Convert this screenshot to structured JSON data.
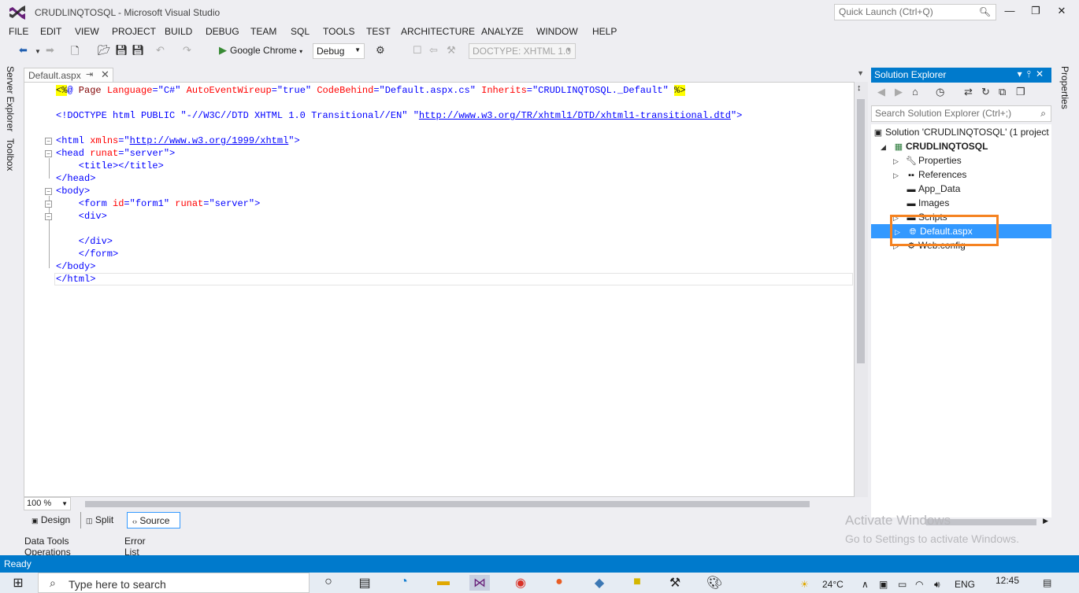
{
  "window": {
    "title": "CRUDLINQTOSQL - Microsoft Visual Studio",
    "quick_launch_placeholder": "Quick Launch (Ctrl+Q)"
  },
  "menu": [
    "FILE",
    "EDIT",
    "VIEW",
    "PROJECT",
    "BUILD",
    "DEBUG",
    "TEAM",
    "SQL",
    "TOOLS",
    "TEST",
    "ARCHITECTURE",
    "ANALYZE",
    "WINDOW",
    "HELP"
  ],
  "toolbar": {
    "run_target": "Google Chrome",
    "configuration": "Debug",
    "doctype": "DOCTYPE: XHTML 1.0"
  },
  "left_strip": {
    "server_explorer": "Server Explorer",
    "toolbox": "Toolbox"
  },
  "editor": {
    "tab_label": "Default.aspx",
    "zoom": "100 %",
    "code": {
      "l1_open": "<%",
      "l1_at": "@",
      "l1_page": " Page ",
      "l1_a1": "Language",
      "l1_v1": "\"C#\"",
      "l1_a2": "AutoEventWireup",
      "l1_v2": "\"true\"",
      "l1_a3": "CodeBehind",
      "l1_v3": "\"Default.aspx.cs\"",
      "l1_a4": "Inherits",
      "l1_v4": "\"CRUDLINQTOSQL._Default\"",
      "l1_close": "%>",
      "l2_start": "<!DOCTYPE html PUBLIC ",
      "l2_fpi": "\"-//W3C//DTD XHTML 1.0 Transitional//EN\"",
      "l2_q": "\"",
      "l2_url": "http://www.w3.org/TR/xhtml1/DTD/xhtml1-transitional.dtd",
      "l2_end": "\">",
      "l3_tag": "<html ",
      "l3_attr": "xmlns",
      "l3_eq": "=\"",
      "l3_url": "http://www.w3.org/1999/xhtml",
      "l3_end": "\">",
      "l4_tag": "<head ",
      "l4_attr": "runat",
      "l4_val": "\"server\"",
      "l4_end": ">",
      "l5": "    <title></title>",
      "l6": "</head>",
      "l7": "<body>",
      "l8_tag": "    <form ",
      "l8_a1": "id",
      "l8_v1": "\"form1\"",
      "l8_a2": "runat",
      "l8_v2": "\"server\"",
      "l8_end": ">",
      "l9": "    <div>",
      "l11": "    </div>",
      "l12": "    </form>",
      "l13": "</body>",
      "l14": "</html>"
    }
  },
  "view_tabs": {
    "design": "Design",
    "split": "Split",
    "source": "Source"
  },
  "bottom_panes": {
    "data_tools": "Data Tools Operations",
    "error_list": "Error List"
  },
  "solution_explorer": {
    "title": "Solution Explorer",
    "search_placeholder": "Search Solution Explorer (Ctrl+;)",
    "solution": "Solution 'CRUDLINQTOSQL' (1 project",
    "project": "CRUDLINQTOSQL",
    "items": [
      "Properties",
      "References",
      "App_Data",
      "Images",
      "Scripts",
      "Default.aspx",
      "Web.config"
    ],
    "selected_item": "Default.aspx"
  },
  "right_strip": {
    "properties": "Properties"
  },
  "watermark": {
    "line1": "Activate Windows",
    "line2": "Go to Settings to activate Windows."
  },
  "status": {
    "text": "Ready"
  },
  "taskbar": {
    "search_placeholder": "Type here to search",
    "weather": "24°C",
    "language": "ENG",
    "time": "12:45"
  },
  "colors": {
    "accent": "#007acc",
    "selection": "#3399ff",
    "highlight_box": "#f58220"
  }
}
